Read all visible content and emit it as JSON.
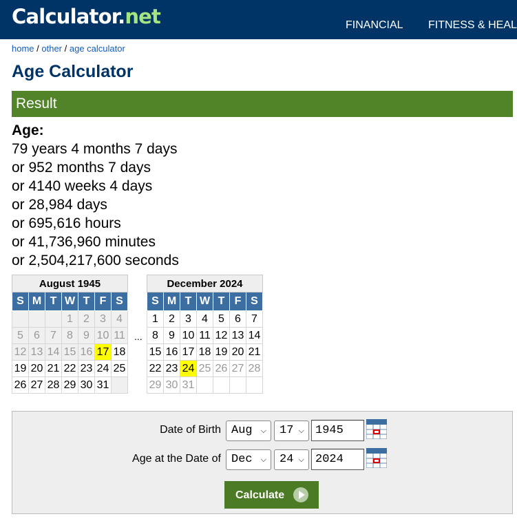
{
  "header": {
    "logo_main": "Calculator",
    "logo_dot": ".",
    "logo_net": "net",
    "nav": [
      "FINANCIAL",
      "FITNESS & HEAL"
    ]
  },
  "breadcrumb": {
    "home": "home",
    "sep1": " / ",
    "other": "other",
    "sep2": " / ",
    "current": "age calculator"
  },
  "page_title": "Age Calculator",
  "result": {
    "heading": "Result",
    "age_label": "Age:",
    "lines": [
      "79 years 4 months 7 days",
      "or 952 months 7 days",
      "or 4140 weeks 4 days",
      "or 28,984 days",
      "or 695,616 hours",
      "or 41,736,960 minutes",
      "or 2,504,217,600 seconds"
    ]
  },
  "calendars": {
    "day_headers": [
      "S",
      "M",
      "T",
      "W",
      "T",
      "F",
      "S"
    ],
    "ellipsis": "...",
    "start": {
      "month": "August 1945",
      "weeks": [
        [
          "",
          "",
          "",
          "1",
          "2",
          "3",
          "4"
        ],
        [
          "5",
          "6",
          "7",
          "8",
          "9",
          "10",
          "11"
        ],
        [
          "12",
          "13",
          "14",
          "15",
          "16",
          "17",
          "18"
        ],
        [
          "19",
          "20",
          "21",
          "22",
          "23",
          "24",
          "25"
        ],
        [
          "26",
          "27",
          "28",
          "29",
          "30",
          "31",
          ""
        ]
      ],
      "highlight": "17"
    },
    "end": {
      "month": "December 2024",
      "weeks": [
        [
          "1",
          "2",
          "3",
          "4",
          "5",
          "6",
          "7"
        ],
        [
          "8",
          "9",
          "10",
          "11",
          "12",
          "13",
          "14"
        ],
        [
          "15",
          "16",
          "17",
          "18",
          "19",
          "20",
          "21"
        ],
        [
          "22",
          "23",
          "24",
          "25",
          "26",
          "27",
          "28"
        ],
        [
          "29",
          "30",
          "31",
          "",
          "",
          "",
          ""
        ]
      ],
      "highlight": "24"
    }
  },
  "form": {
    "dob_label": "Date of Birth",
    "dob_month": "Aug",
    "dob_day": "17",
    "dob_year": "1945",
    "at_label": "Age at the Date of",
    "at_month": "Dec",
    "at_day": "24",
    "at_year": "2024",
    "calculate_label": "Calculate"
  },
  "colors": {
    "header_bg": "#003366",
    "result_bar": "#518428",
    "day_header_bg": "#3c6ea1",
    "highlight": "#ffff00",
    "button": "#4c7b25"
  }
}
